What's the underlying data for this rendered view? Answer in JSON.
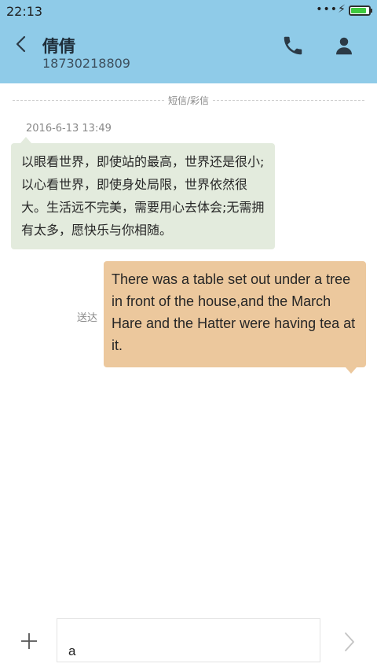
{
  "status_bar": {
    "time": "22:13",
    "dots": "•••",
    "bolt": "⚡",
    "battery_level": 0.85,
    "battery_color": "#3fc93f"
  },
  "header": {
    "background": "#8fcbe8",
    "contact_name": "倩倩",
    "contact_number": "18730218809",
    "icons": [
      "back-arrow-icon",
      "phone-icon",
      "person-icon"
    ]
  },
  "divider": {
    "label": "短信/彩信"
  },
  "conversation": {
    "timestamp": "2016-6-13 13:49",
    "incoming": {
      "text": "以眼看世界，即使站的最高，世界还是很小;以心看世界，即使身处局限，世界依然很大。生活远不完美，需要用心去体会;无需拥有太多，愿快乐与你相随。",
      "color": "#e3ebdd"
    },
    "outgoing": {
      "status": "送达",
      "text": "There was a table set out under a tree in front of the house,and the March Hare and the Hatter were having tea at it.",
      "color": "#ecc89d"
    }
  },
  "composer": {
    "value": "a",
    "icons": [
      "plus-icon",
      "chevron-right-icon"
    ]
  }
}
